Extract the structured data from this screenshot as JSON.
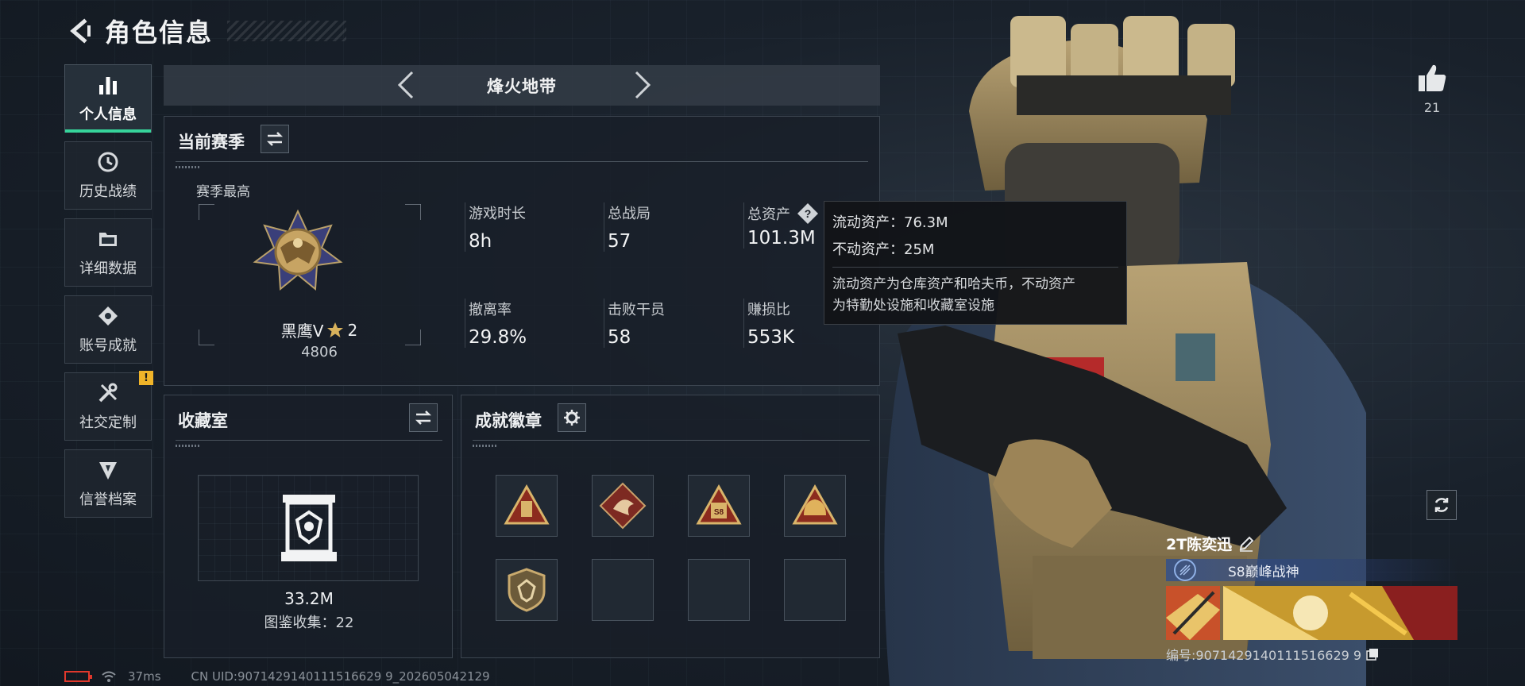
{
  "header": {
    "title": "角色信息"
  },
  "sidebar": {
    "items": [
      {
        "label": "个人信息",
        "icon": "bar-chart-icon",
        "active": true
      },
      {
        "label": "历史战绩",
        "icon": "history-clock-icon"
      },
      {
        "label": "详细数据",
        "icon": "folder-icon"
      },
      {
        "label": "账号成就",
        "icon": "achievement-icon"
      },
      {
        "label": "社交定制",
        "icon": "tools-icon",
        "badge": "!"
      },
      {
        "label": "信誉档案",
        "icon": "reputation-icon"
      }
    ]
  },
  "mode": {
    "title": "烽火地带"
  },
  "season": {
    "title": "当前赛季",
    "best_label": "赛季最高",
    "rank_name": "黑鹰V",
    "rank_stars": "2",
    "rank_score": "4806",
    "stats": [
      {
        "label": "游戏时长",
        "value": "8h"
      },
      {
        "label": "总战局",
        "value": "57"
      },
      {
        "label": "总资产",
        "value": "101.3M"
      },
      {
        "label": "撤离率",
        "value": "29.8%"
      },
      {
        "label": "击败干员",
        "value": "58"
      },
      {
        "label": "赚损比",
        "value": "553K"
      }
    ]
  },
  "tooltip": {
    "liquid": "流动资产：76.3M",
    "fixed": "不动资产：25M",
    "desc_line1": "流动资产为仓库资产和哈夫币，不动资产",
    "desc_line2": "为特勤处设施和收藏室设施"
  },
  "collection": {
    "title": "收藏室",
    "value": "33.2M",
    "count": "图鉴收集：22"
  },
  "badges": {
    "title": "成就徽章",
    "slots": [
      "badge-supply-icon",
      "badge-dragon-icon",
      "badge-s8-icon",
      "badge-helmet-icon",
      "badge-shield-icon",
      "",
      "",
      ""
    ]
  },
  "like": {
    "count": "21"
  },
  "player": {
    "name": "2T陈奕迅",
    "title": "S8巅峰战神",
    "id": "编号:9071429140111516629 9"
  },
  "status": {
    "ping": "37ms",
    "uid": "CN UID:9071429140111516629 9_202605042129"
  },
  "colors": {
    "accent": "#36d49b",
    "warning": "#f0b429",
    "battery": "#e0382c"
  }
}
